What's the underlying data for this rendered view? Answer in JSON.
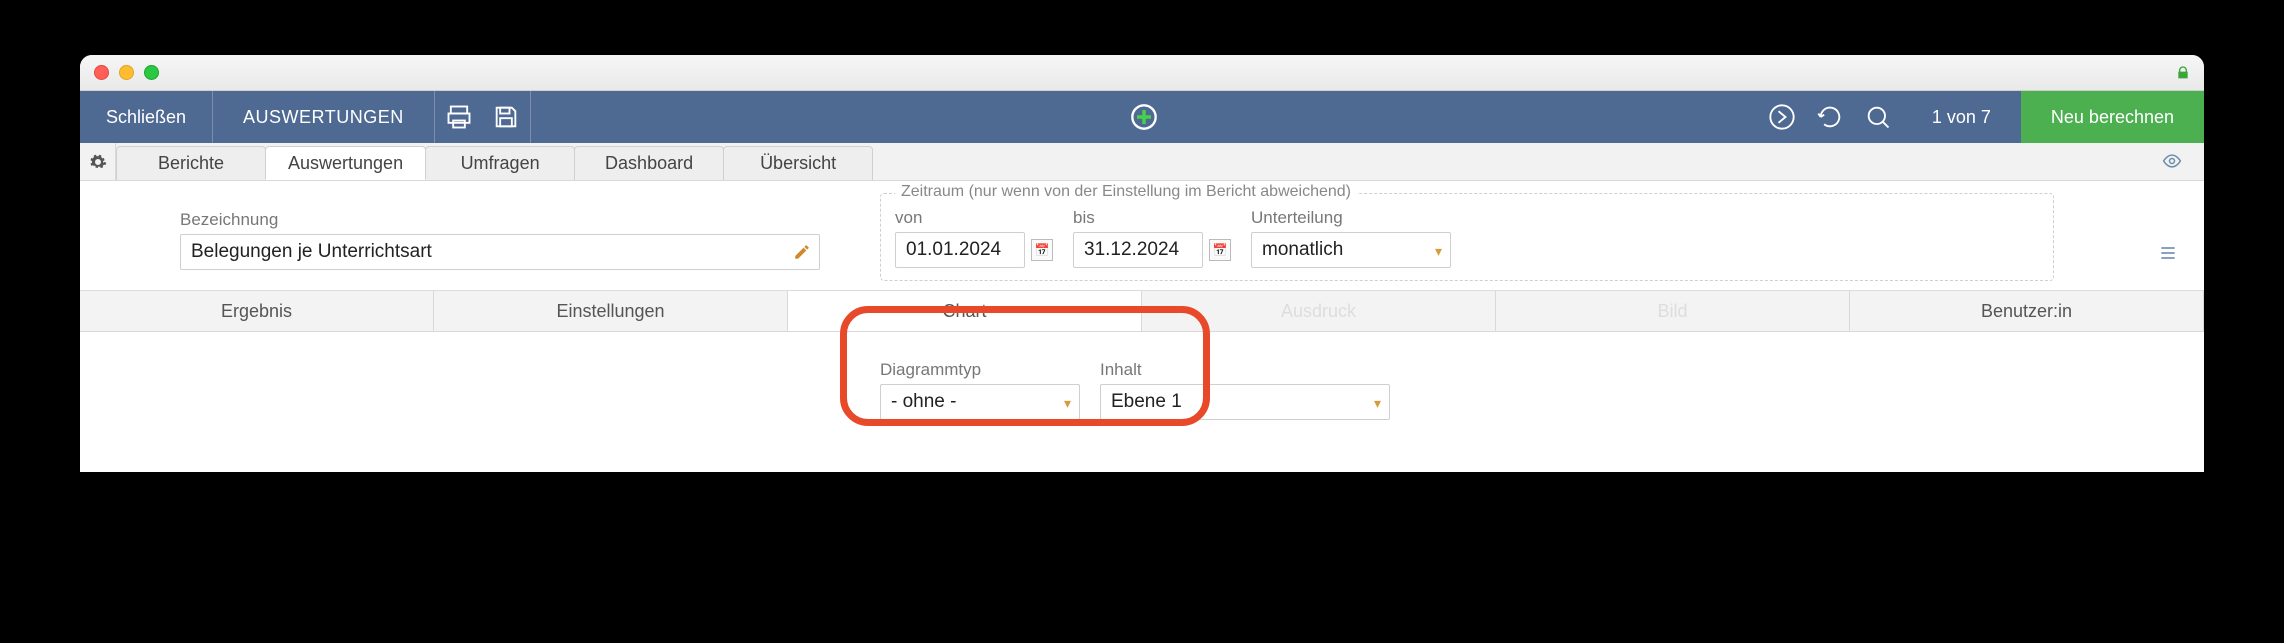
{
  "ribbon": {
    "close": "Schließen",
    "title": "AUSWERTUNGEN",
    "counter": "1 von 7",
    "neu": "Neu berechnen"
  },
  "nav_tabs": {
    "berichte": "Berichte",
    "auswertungen": "Auswertungen",
    "umfragen": "Umfragen",
    "dashboard": "Dashboard",
    "uebersicht": "Übersicht"
  },
  "filters": {
    "bezeichnung_label": "Bezeichnung",
    "bezeichnung_value": "Belegungen je Unterrichtsart",
    "zeitraum_legend": "Zeitraum (nur wenn von der Einstellung im Bericht abweichend)",
    "von_label": "von",
    "von_value": "01.01.2024",
    "bis_label": "bis",
    "bis_value": "31.12.2024",
    "unterteilung_label": "Unterteilung",
    "unterteilung_value": "monatlich"
  },
  "subtabs": {
    "ergebnis": "Ergebnis",
    "einstellungen": "Einstellungen",
    "chart": "Chart",
    "ausdruck": "Ausdruck",
    "bild": "Bild",
    "benutzer": "Benutzer:in"
  },
  "chart_panel": {
    "diagrammtyp_label": "Diagrammtyp",
    "diagrammtyp_value": "- ohne -",
    "inhalt_label": "Inhalt",
    "inhalt_value": "Ebene 1"
  }
}
